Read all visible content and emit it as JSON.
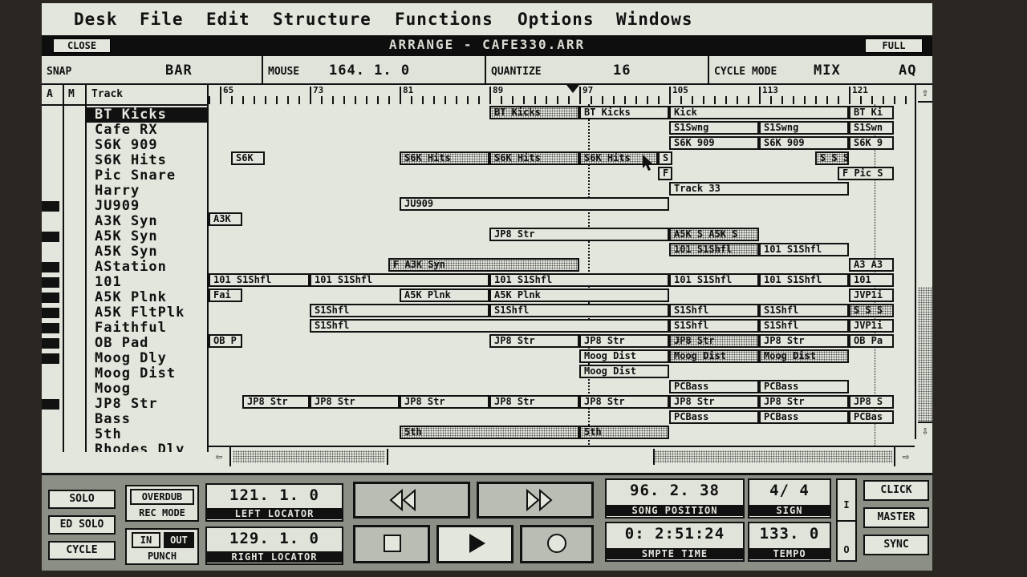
{
  "menu": [
    "Desk",
    "File",
    "Edit",
    "Structure",
    "Functions",
    "Options",
    "Windows"
  ],
  "window": {
    "title": "ARRANGE - CAFE330.ARR",
    "close_label": "CLOSE",
    "full_label": "FULL"
  },
  "info": {
    "snap_label": "SNAP",
    "snap_value": "BAR",
    "mouse_label": "MOUSE",
    "mouse_value": "164. 1. 0",
    "quantize_label": "QUANTIZE",
    "quantize_value": "16",
    "cycle_label": "CYCLE MODE",
    "cycle_value": "MIX",
    "cycle_extra": "AQ"
  },
  "track_header": {
    "a": "A",
    "m": "M",
    "track": "Track"
  },
  "tracks": [
    "BT Kicks",
    "Cafe RX",
    "S6K 909",
    "S6K Hits",
    "Pic Snare",
    "Harry",
    "JU909",
    "A3K Syn",
    "A5K Syn",
    "A5K Syn",
    "AStation",
    "101",
    "A5K Plnk",
    "A5K FltPlk",
    "Faithful",
    "OB Pad",
    "Moog Dly",
    "Moog Dist",
    "Moog",
    "JP8 Str",
    "Bass",
    "5th",
    "Rhodes Dly"
  ],
  "ruler": [
    "65",
    "73",
    "81",
    "89",
    "97",
    "105",
    "113",
    "121"
  ],
  "regions": [
    {
      "row": 0,
      "start": 89,
      "end": 97,
      "label": "BT Kicks",
      "dot": true
    },
    {
      "row": 0,
      "start": 97,
      "end": 105,
      "label": "BT Kicks",
      "dot": false
    },
    {
      "row": 0,
      "start": 105,
      "end": 121,
      "label": "Kick",
      "dot": false
    },
    {
      "row": 0,
      "start": 121,
      "end": 125,
      "label": "BT Ki",
      "dot": false
    },
    {
      "row": 1,
      "start": 105,
      "end": 113,
      "label": "S1Swng",
      "dot": false
    },
    {
      "row": 1,
      "start": 113,
      "end": 121,
      "label": "S1Swng",
      "dot": false
    },
    {
      "row": 1,
      "start": 121,
      "end": 125,
      "label": "S1Swn",
      "dot": false
    },
    {
      "row": 2,
      "start": 105,
      "end": 113,
      "label": "S6K 909",
      "dot": false
    },
    {
      "row": 2,
      "start": 113,
      "end": 121,
      "label": "S6K 909",
      "dot": false
    },
    {
      "row": 2,
      "start": 121,
      "end": 125,
      "label": "S6K 9",
      "dot": false
    },
    {
      "row": 3,
      "start": 66,
      "end": 69,
      "label": "S6K",
      "dot": false
    },
    {
      "row": 3,
      "start": 81,
      "end": 89,
      "label": "S6K Hits",
      "dot": true
    },
    {
      "row": 3,
      "start": 89,
      "end": 97,
      "label": "S6K Hits",
      "dot": true
    },
    {
      "row": 3,
      "start": 97,
      "end": 104,
      "label": "S6K Hits",
      "dot": true
    },
    {
      "row": 3,
      "start": 104,
      "end": 105,
      "label": "S",
      "dot": false
    },
    {
      "row": 3,
      "start": 118,
      "end": 121,
      "label": "S S S",
      "dot": true
    },
    {
      "row": 4,
      "start": 104,
      "end": 105,
      "label": "F",
      "dot": false
    },
    {
      "row": 4,
      "start": 120,
      "end": 125,
      "label": "F Pic S",
      "dot": false
    },
    {
      "row": 5,
      "start": 105,
      "end": 121,
      "label": "Track 33",
      "dot": false
    },
    {
      "row": 6,
      "start": 81,
      "end": 105,
      "label": "JU909",
      "dot": false
    },
    {
      "row": 7,
      "start": 64,
      "end": 67,
      "label": "A3K",
      "dot": false
    },
    {
      "row": 8,
      "start": 89,
      "end": 105,
      "label": "JP8 Str",
      "dot": false
    },
    {
      "row": 8,
      "start": 105,
      "end": 113,
      "label": "A5K S A5K S",
      "dot": true
    },
    {
      "row": 9,
      "start": 105,
      "end": 113,
      "label": "101 S1Shfl",
      "dot": true
    },
    {
      "row": 9,
      "start": 113,
      "end": 121,
      "label": "101 S1Shfl",
      "dot": false
    },
    {
      "row": 10,
      "start": 80,
      "end": 97,
      "label": "F A3K Syn",
      "dot": true
    },
    {
      "row": 10,
      "start": 121,
      "end": 125,
      "label": "A3 A3",
      "dot": false
    },
    {
      "row": 11,
      "start": 64,
      "end": 73,
      "label": "101 S1Shfl",
      "dot": false
    },
    {
      "row": 11,
      "start": 73,
      "end": 89,
      "label": "101 S1Shfl",
      "dot": false
    },
    {
      "row": 11,
      "start": 89,
      "end": 105,
      "label": "101 S1Shfl",
      "dot": false
    },
    {
      "row": 11,
      "start": 105,
      "end": 113,
      "label": "101 S1Shfl",
      "dot": false
    },
    {
      "row": 11,
      "start": 113,
      "end": 121,
      "label": "101 S1Shfl",
      "dot": false
    },
    {
      "row": 11,
      "start": 121,
      "end": 125,
      "label": "101",
      "dot": false
    },
    {
      "row": 12,
      "start": 64,
      "end": 67,
      "label": "Fai",
      "dot": false
    },
    {
      "row": 12,
      "start": 81,
      "end": 89,
      "label": "A5K Plnk",
      "dot": false
    },
    {
      "row": 12,
      "start": 89,
      "end": 105,
      "label": "A5K Plnk",
      "dot": false
    },
    {
      "row": 12,
      "start": 121,
      "end": 125,
      "label": "JVP1i",
      "dot": false
    },
    {
      "row": 13,
      "start": 73,
      "end": 89,
      "label": "S1Shfl",
      "dot": false
    },
    {
      "row": 13,
      "start": 89,
      "end": 105,
      "label": "S1Shfl",
      "dot": false
    },
    {
      "row": 13,
      "start": 105,
      "end": 113,
      "label": "S1Shfl",
      "dot": false
    },
    {
      "row": 13,
      "start": 113,
      "end": 121,
      "label": "S1Shfl",
      "dot": false
    },
    {
      "row": 13,
      "start": 121,
      "end": 125,
      "label": "S S S",
      "dot": true
    },
    {
      "row": 14,
      "start": 73,
      "end": 105,
      "label": "S1Shfl",
      "dot": false
    },
    {
      "row": 14,
      "start": 105,
      "end": 113,
      "label": "S1Shfl",
      "dot": false
    },
    {
      "row": 14,
      "start": 113,
      "end": 121,
      "label": "S1Shfl",
      "dot": false
    },
    {
      "row": 14,
      "start": 121,
      "end": 125,
      "label": "JVP1i",
      "dot": false
    },
    {
      "row": 15,
      "start": 64,
      "end": 67,
      "label": "OB P",
      "dot": false
    },
    {
      "row": 15,
      "start": 89,
      "end": 97,
      "label": "JP8 Str",
      "dot": false
    },
    {
      "row": 15,
      "start": 97,
      "end": 105,
      "label": "JP8 Str",
      "dot": false
    },
    {
      "row": 15,
      "start": 105,
      "end": 113,
      "label": "JP8 Str",
      "dot": true
    },
    {
      "row": 15,
      "start": 113,
      "end": 121,
      "label": "JP8 Str",
      "dot": false
    },
    {
      "row": 15,
      "start": 121,
      "end": 125,
      "label": "OB Pa",
      "dot": false
    },
    {
      "row": 16,
      "start": 97,
      "end": 105,
      "label": "Moog Dist",
      "dot": false
    },
    {
      "row": 16,
      "start": 105,
      "end": 113,
      "label": "Moog Dist",
      "dot": true
    },
    {
      "row": 16,
      "start": 113,
      "end": 121,
      "label": "Moog Dist",
      "dot": true
    },
    {
      "row": 17,
      "start": 97,
      "end": 105,
      "label": "Moog Dist",
      "dot": false
    },
    {
      "row": 18,
      "start": 105,
      "end": 113,
      "label": "PCBass",
      "dot": false
    },
    {
      "row": 18,
      "start": 113,
      "end": 121,
      "label": "PCBass",
      "dot": false
    },
    {
      "row": 19,
      "start": 67,
      "end": 73,
      "label": "JP8 Str",
      "dot": false
    },
    {
      "row": 19,
      "start": 73,
      "end": 81,
      "label": "JP8 Str",
      "dot": false
    },
    {
      "row": 19,
      "start": 81,
      "end": 89,
      "label": "JP8 Str",
      "dot": false
    },
    {
      "row": 19,
      "start": 89,
      "end": 97,
      "label": "JP8 Str",
      "dot": false
    },
    {
      "row": 19,
      "start": 97,
      "end": 105,
      "label": "JP8 Str",
      "dot": false
    },
    {
      "row": 19,
      "start": 105,
      "end": 113,
      "label": "JP8 Str",
      "dot": false
    },
    {
      "row": 19,
      "start": 113,
      "end": 121,
      "label": "JP8 Str",
      "dot": false
    },
    {
      "row": 19,
      "start": 121,
      "end": 125,
      "label": "JP8 S",
      "dot": false
    },
    {
      "row": 20,
      "start": 105,
      "end": 113,
      "label": "PCBass",
      "dot": false
    },
    {
      "row": 20,
      "start": 113,
      "end": 121,
      "label": "PCBass",
      "dot": false
    },
    {
      "row": 20,
      "start": 121,
      "end": 125,
      "label": "PCBas",
      "dot": false
    },
    {
      "row": 21,
      "start": 81,
      "end": 97,
      "label": "5th",
      "dot": true
    },
    {
      "row": 21,
      "start": 97,
      "end": 105,
      "label": "5th",
      "dot": true
    }
  ],
  "transport": {
    "solo": "SOLO",
    "ed_solo": "ED SOLO",
    "cycle": "CYCLE",
    "overdub": "OVERDUB",
    "rec_mode": "REC MODE",
    "in": "IN",
    "out": "OUT",
    "punch": "PUNCH",
    "left_locator": "121. 1. 0",
    "left_locator_label": "LEFT LOCATOR",
    "right_locator": "129. 1. 0",
    "right_locator_label": "RIGHT LOCATOR",
    "song_position": "96. 2. 38",
    "song_position_label": "SONG POSITION",
    "sign": "4/ 4",
    "sign_label": "SIGN",
    "smpte": "0: 2:51:24",
    "smpte_label": "SMPTE TIME",
    "tempo": "133. 0",
    "tempo_label": "TEMPO",
    "click": "CLICK",
    "master": "MASTER",
    "sync": "SYNC",
    "meter_i": "I",
    "meter_o": "O"
  }
}
